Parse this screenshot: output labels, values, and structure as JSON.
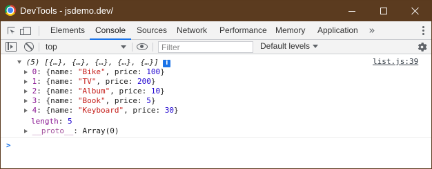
{
  "window": {
    "title": "DevTools - jsdemo.dev/"
  },
  "tabs": [
    {
      "label": "Elements"
    },
    {
      "label": "Console",
      "active": true
    },
    {
      "label": "Sources"
    },
    {
      "label": "Network"
    },
    {
      "label": "Performance"
    },
    {
      "label": "Memory"
    },
    {
      "label": "Application"
    }
  ],
  "toolbar": {
    "context": "top",
    "filter_placeholder": "Filter",
    "levels": "Default levels"
  },
  "console": {
    "source": "list.js:39",
    "summary": {
      "count": "(5)",
      "preview": "[{…}, {…}, {…}, {…}, {…}]",
      "badge": "i"
    },
    "items": [
      {
        "index": "0",
        "name": "\"Bike\"",
        "price": "100"
      },
      {
        "index": "1",
        "name": "\"TV\"",
        "price": "200"
      },
      {
        "index": "2",
        "name": "\"Album\"",
        "price": "10"
      },
      {
        "index": "3",
        "name": "\"Book\"",
        "price": "5"
      },
      {
        "index": "4",
        "name": "\"Keyboard\"",
        "price": "30"
      }
    ],
    "length_key": "length",
    "length_value": "5",
    "proto_key": "__proto__",
    "proto_value": "Array(0)",
    "prompt": ">"
  },
  "colors": {
    "titlebar": "#5b3b1f",
    "accent": "#1a73e8",
    "string": "#c41a16",
    "number": "#1c00cf",
    "key": "#881391"
  }
}
